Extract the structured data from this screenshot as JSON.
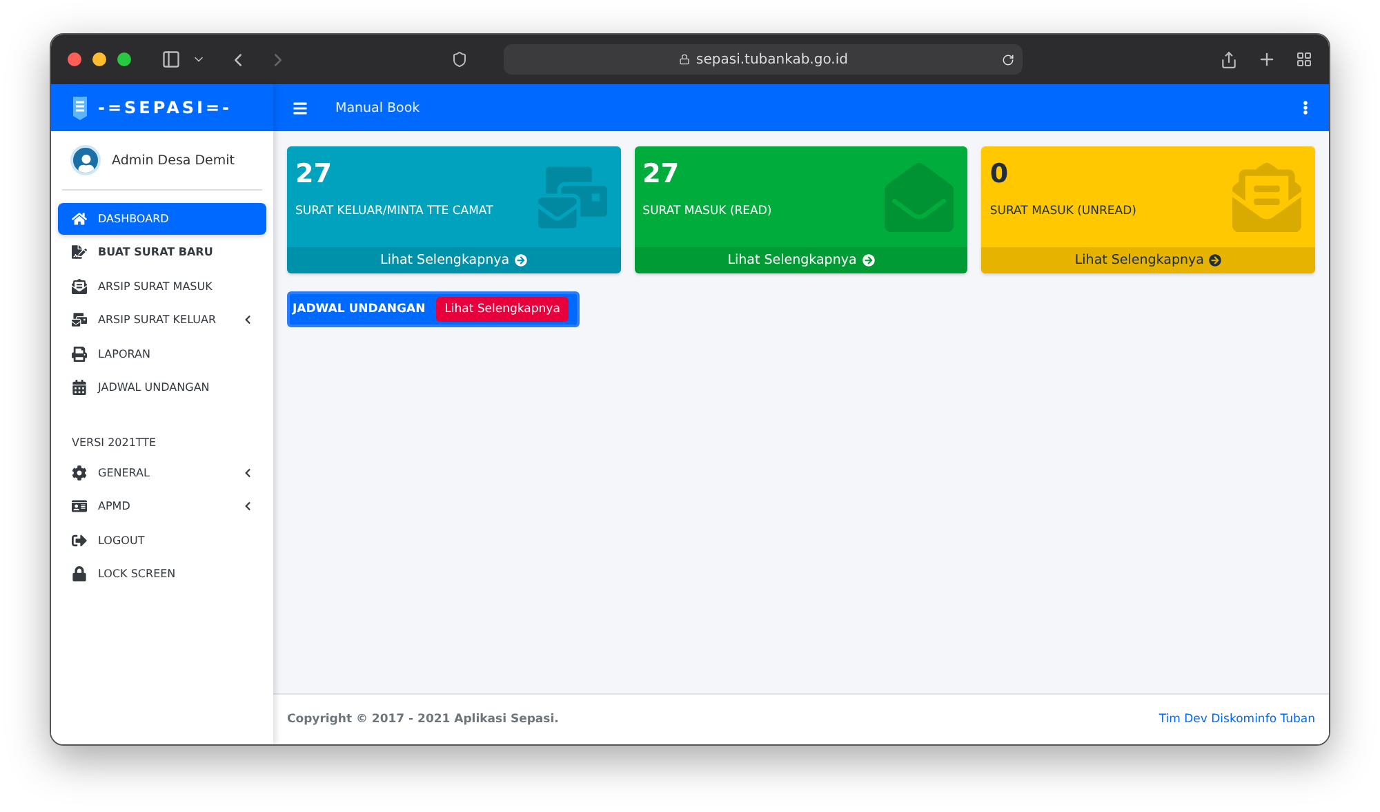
{
  "browser": {
    "url": "sepasi.tubankab.go.id"
  },
  "brand": {
    "logo_text": "-=SEPASI=-"
  },
  "topbar": {
    "link": "Manual Book"
  },
  "user": {
    "name": "Admin Desa Demit"
  },
  "sidebar": {
    "items": [
      {
        "label": "DASHBOARD",
        "selected": true,
        "bold": false,
        "has_submenu": false
      },
      {
        "label": "BUAT SURAT BARU",
        "selected": false,
        "bold": true,
        "has_submenu": false
      },
      {
        "label": "ARSIP SURAT MASUK",
        "selected": false,
        "bold": false,
        "has_submenu": false
      },
      {
        "label": "ARSIP SURAT KELUAR",
        "selected": false,
        "bold": false,
        "has_submenu": true
      },
      {
        "label": "LAPORAN",
        "selected": false,
        "bold": false,
        "has_submenu": false
      },
      {
        "label": "JADWAL UNDANGAN",
        "selected": false,
        "bold": false,
        "has_submenu": false
      }
    ],
    "section_header": "VERSI 2021TTE",
    "section_items": [
      {
        "label": "GENERAL",
        "selected": false,
        "bold": false,
        "has_submenu": true
      },
      {
        "label": "APMD",
        "selected": false,
        "bold": false,
        "has_submenu": true
      },
      {
        "label": "LOGOUT",
        "selected": false,
        "bold": false,
        "has_submenu": false
      },
      {
        "label": "LOCK SCREEN",
        "selected": false,
        "bold": false,
        "has_submenu": false
      }
    ]
  },
  "cards": [
    {
      "count": "27",
      "label": "SURAT KELUAR/MINTA TTE CAMAT",
      "link": "Lihat Selengkapnya",
      "color": "#00a2be"
    },
    {
      "count": "27",
      "label": "SURAT MASUK (READ)",
      "link": "Lihat Selengkapnya",
      "color": "#00ad3c"
    },
    {
      "count": "0",
      "label": "SURAT MASUK (UNREAD)",
      "link": "Lihat Selengkapnya",
      "color": "#ffc800"
    }
  ],
  "schedule": {
    "title": "JADWAL UNDANGAN",
    "button": "Lihat Selengkapnya"
  },
  "footer": {
    "copyright": "Copyright © 2017 - 2021 Aplikasi Sepasi.",
    "credit": "Tim Dev Diskominfo Tuban"
  }
}
